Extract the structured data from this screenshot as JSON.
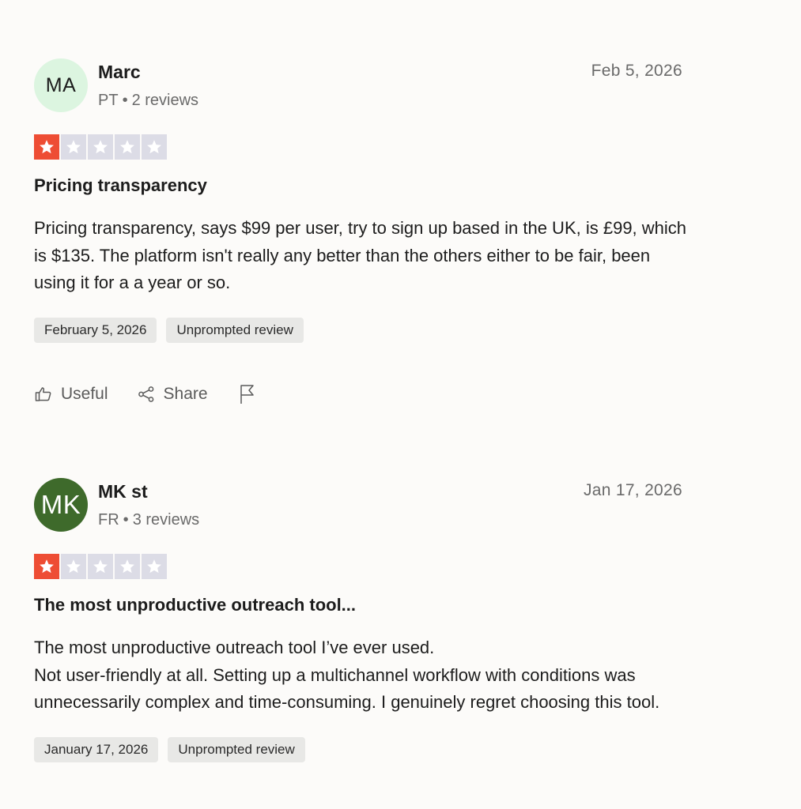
{
  "colors": {
    "star_filled": "#ee4d34",
    "star_empty": "#dcdce6",
    "avatar_ma_bg": "#dcf5e0",
    "avatar_mk_bg": "#3e6a2b"
  },
  "actions": {
    "useful_label": "Useful",
    "share_label": "Share",
    "useful_icon": "thumbs-up-icon",
    "share_icon": "share-icon",
    "flag_icon": "flag-icon"
  },
  "reviews": [
    {
      "initials": "MA",
      "name": "Marc",
      "country": "PT",
      "separator": "•",
      "review_count": "2 reviews",
      "date": "Feb 5, 2026",
      "rating": 1,
      "title": "Pricing transparency",
      "body_lines": [
        "Pricing transparency, says $99 per user, try to sign up based in the UK, is £99, which is $135. The platform isn't really any better than the others either to be fair, been using it for a a year or so."
      ],
      "tags": [
        "February 5, 2026",
        "Unprompted review"
      ]
    },
    {
      "initials": "MK",
      "name": "MK st",
      "country": "FR",
      "separator": "•",
      "review_count": "3 reviews",
      "date": "Jan 17, 2026",
      "rating": 1,
      "title": "The most unproductive outreach tool...",
      "body_lines": [
        "The most unproductive outreach tool I’ve ever used.",
        "Not user-friendly at all. Setting up a multichannel workflow with conditions was unnecessarily complex and time-consuming. I genuinely regret choosing this tool."
      ],
      "tags": [
        "January 17, 2026",
        "Unprompted review"
      ]
    }
  ]
}
